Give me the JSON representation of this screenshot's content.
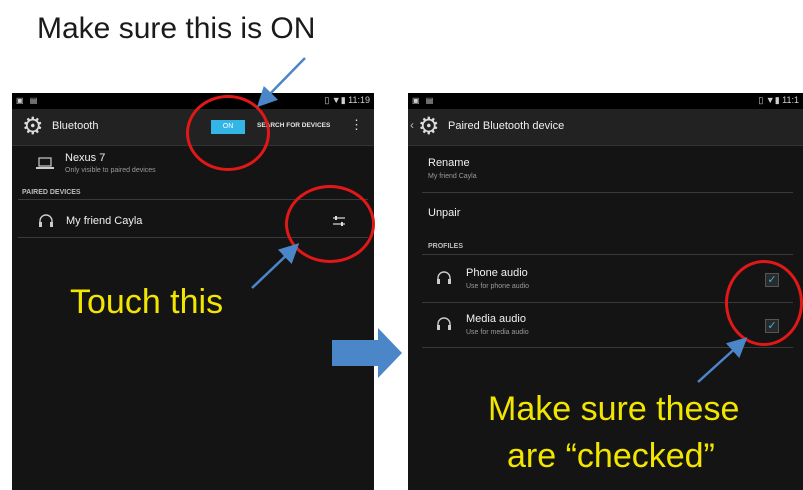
{
  "captions": {
    "top": "Make sure this is ON",
    "touch": "Touch this",
    "checked_line1": "Make sure these",
    "checked_line2": "are “checked”"
  },
  "left_screen": {
    "status": {
      "left_icons": "▣ ▤",
      "right_text": "▯ ▼▮ 11:19"
    },
    "action_bar": {
      "title": "Bluetooth",
      "toggle_label": "ON",
      "search_label": "SEARCH FOR DEVICES",
      "overflow_icon": "overflow-menu-icon"
    },
    "this_device": {
      "name": "Nexus 7",
      "subtitle": "Only visible to paired devices",
      "icon": "laptop-icon"
    },
    "paired_header": "PAIRED DEVICES",
    "paired_device": {
      "name": "My friend Cayla",
      "icon": "headphones-icon",
      "settings_icon": "settings-sliders-icon"
    }
  },
  "right_screen": {
    "status": {
      "left_icons": "▣ ▤",
      "right_text": "▯ ▼▮ 11:1"
    },
    "action_bar": {
      "title": "Paired Bluetooth device",
      "back_icon": "back-chevron-icon"
    },
    "rename": {
      "label": "Rename",
      "value": "My friend Cayla"
    },
    "unpair_label": "Unpair",
    "profiles_header": "PROFILES",
    "profiles": [
      {
        "name": "Phone audio",
        "subtitle": "Use for phone audio",
        "checked": true
      },
      {
        "name": "Media audio",
        "subtitle": "Use for media audio",
        "checked": true
      }
    ]
  },
  "colors": {
    "accent": "#33b5e5",
    "caption_yellow": "#f2e600",
    "circle_red": "#e01818",
    "arrow_blue": "#4a86c8"
  }
}
